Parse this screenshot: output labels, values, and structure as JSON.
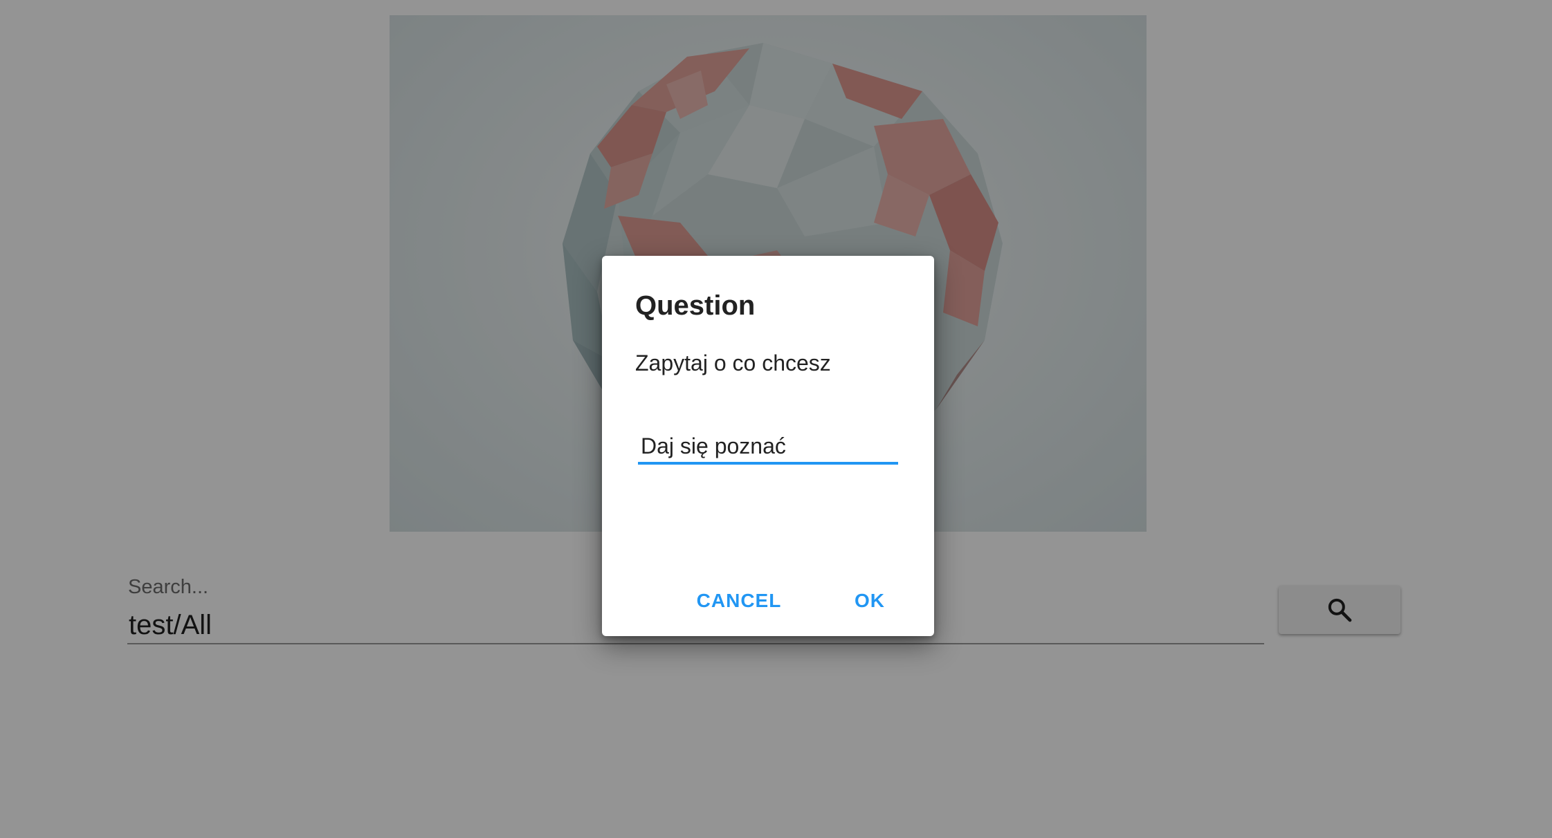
{
  "hero": {
    "image": "low-poly-globe",
    "colors": {
      "ocean": "#cfdcdc",
      "land": "#e6a39c",
      "background": "#e8eeef"
    }
  },
  "search": {
    "placeholder": "Search...",
    "value": "test/All",
    "button_icon": "search-icon"
  },
  "dialog": {
    "title": "Question",
    "message": "Zapytaj o co chcesz",
    "input_value": "Daj się poznać",
    "cancel_label": "CANCEL",
    "ok_label": "OK",
    "accent_color": "#2196f3"
  }
}
